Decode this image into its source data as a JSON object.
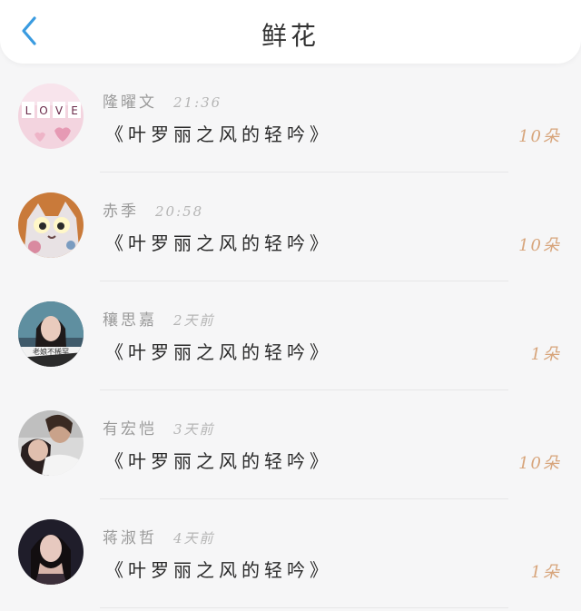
{
  "header": {
    "title": "鲜花",
    "back_icon": "chevron-left-icon",
    "accent_color": "#3a9be0"
  },
  "items": [
    {
      "name": "隆曜文",
      "time": "21:36",
      "work": "《叶罗丽之风的轻吟》",
      "count": "10朵",
      "avatar": "love-letters-avatar"
    },
    {
      "name": "赤季",
      "time": "20:58",
      "work": "《叶罗丽之风的轻吟》",
      "count": "10朵",
      "avatar": "cartoon-cat-avatar"
    },
    {
      "name": "穰思嘉",
      "time": "2天前",
      "work": "《叶罗丽之风的轻吟》",
      "count": "1朵",
      "avatar": "girl-portrait-avatar",
      "avatar_caption": "老娘不稀罕"
    },
    {
      "name": "有宏恺",
      "time": "3天前",
      "work": "《叶罗丽之风的轻吟》",
      "count": "10朵",
      "avatar": "couple-photo-avatar"
    },
    {
      "name": "蒋淑哲",
      "time": "4天前",
      "work": "《叶罗丽之风的轻吟》",
      "count": "1朵",
      "avatar": "woman-portrait-avatar"
    }
  ],
  "count_color": "#d7a47a"
}
